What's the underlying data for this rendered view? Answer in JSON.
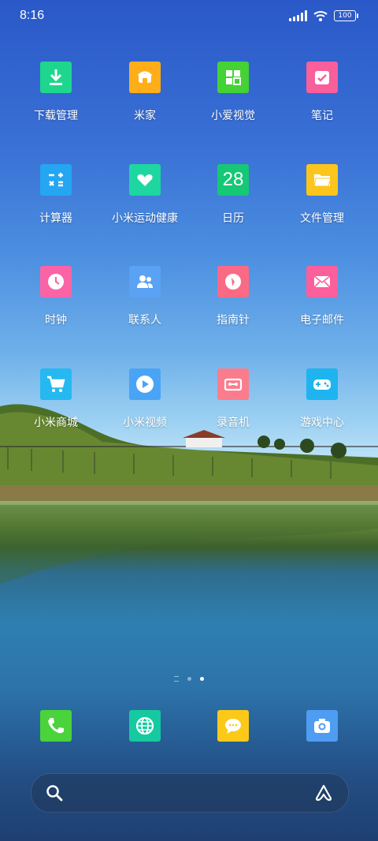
{
  "status_bar": {
    "time": "8:16",
    "battery": "100"
  },
  "apps": [
    {
      "label": "下载管理",
      "icon": "download-icon",
      "color": "#1fd68e"
    },
    {
      "label": "米家",
      "icon": "mijia-icon",
      "color": "#ffae1a"
    },
    {
      "label": "小爱视觉",
      "icon": "vision-icon",
      "color": "#44d234"
    },
    {
      "label": "笔记",
      "icon": "notes-icon",
      "color": "#f85f9b"
    },
    {
      "label": "计算器",
      "icon": "calculator-icon",
      "color": "#24a6f2"
    },
    {
      "label": "小米运动健康",
      "icon": "health-icon",
      "color": "#1ed6a0"
    },
    {
      "label": "日历",
      "icon": "calendar-icon",
      "color": "#16c776",
      "value": "28"
    },
    {
      "label": "文件管理",
      "icon": "folder-icon",
      "color": "#fcc51d"
    },
    {
      "label": "时钟",
      "icon": "clock-icon",
      "color": "#fa64a6"
    },
    {
      "label": "联系人",
      "icon": "contacts-icon",
      "color": "#5aa2f4"
    },
    {
      "label": "指南针",
      "icon": "compass-icon",
      "color": "#fb6a85"
    },
    {
      "label": "电子邮件",
      "icon": "mail-icon",
      "color": "#fb5f9c"
    },
    {
      "label": "小米商城",
      "icon": "cart-icon",
      "color": "#26b8f0"
    },
    {
      "label": "小米视频",
      "icon": "play-icon",
      "color": "#4aa4f6"
    },
    {
      "label": "录音机",
      "icon": "recorder-icon",
      "color": "#fb7c8c"
    },
    {
      "label": "游戏中心",
      "icon": "gamepad-icon",
      "color": "#1eb4ef"
    }
  ],
  "dock": [
    {
      "icon": "phone-icon",
      "color": "#4ad33a"
    },
    {
      "icon": "browser-icon",
      "color": "#15c9a0"
    },
    {
      "icon": "messages-icon",
      "color": "#fcc919"
    },
    {
      "icon": "camera-icon",
      "color": "#4f9cf3"
    }
  ],
  "pager": {
    "pages": 2,
    "current": 2
  },
  "search_bar": {
    "icon": "search-icon",
    "assistant_icon": "assistant-icon"
  }
}
